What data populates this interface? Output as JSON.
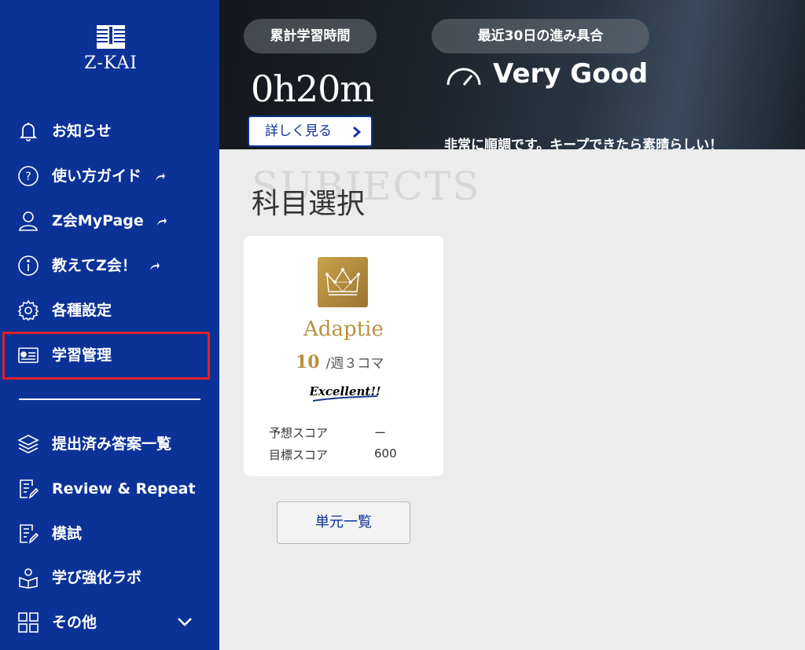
{
  "brand": {
    "logo_text": "Z-KAI"
  },
  "sidebar": {
    "items": [
      {
        "label": "お知らせ",
        "icon": "bell-icon",
        "external": false
      },
      {
        "label": "使い方ガイド",
        "icon": "help-circle-icon",
        "external": true
      },
      {
        "label": "Z会MyPage",
        "icon": "user-icon",
        "external": true
      },
      {
        "label": "教えてZ会！",
        "icon": "info-circle-icon",
        "external": true
      },
      {
        "label": "各種設定",
        "icon": "gear-icon",
        "external": false
      },
      {
        "label": "学習管理",
        "icon": "study-card-icon",
        "external": false,
        "highlighted": true
      }
    ],
    "sub_items": [
      {
        "label": "提出済み答案一覧",
        "icon": "layers-icon"
      },
      {
        "label": "Review & Repeat",
        "icon": "notebook-pen-icon"
      },
      {
        "label": "模試",
        "icon": "notebook-pen-icon"
      },
      {
        "label": "学び強化ラボ",
        "icon": "reader-icon"
      },
      {
        "label": "その他",
        "icon": "grid-icon",
        "expandable": true
      }
    ]
  },
  "hero": {
    "total_time_label": "累計学習時間",
    "total_time_value": "0h20m",
    "detail_button": "詳しく見る",
    "recent_label": "最近30日の進み具合",
    "status": "Very Good",
    "status_comment": "非常に順調です。キープできたら素晴らしい！"
  },
  "main": {
    "section_bg_text": "SUBJECTS",
    "section_title": "科目選択",
    "subject_card": {
      "name": "Adaptie",
      "weekly_count": "10",
      "weekly_unit": "/週３コマ",
      "badge": "Excellent!!",
      "scores": [
        {
          "label": "予想スコア",
          "value": "ー"
        },
        {
          "label": "目標スコア",
          "value": "600"
        }
      ]
    },
    "units_button": "単元一覧"
  },
  "colors": {
    "sidebar_bg": "#0b3296",
    "highlight_border": "#e0202a",
    "gold": "#b8913e",
    "page_bg": "#ebeceb"
  }
}
